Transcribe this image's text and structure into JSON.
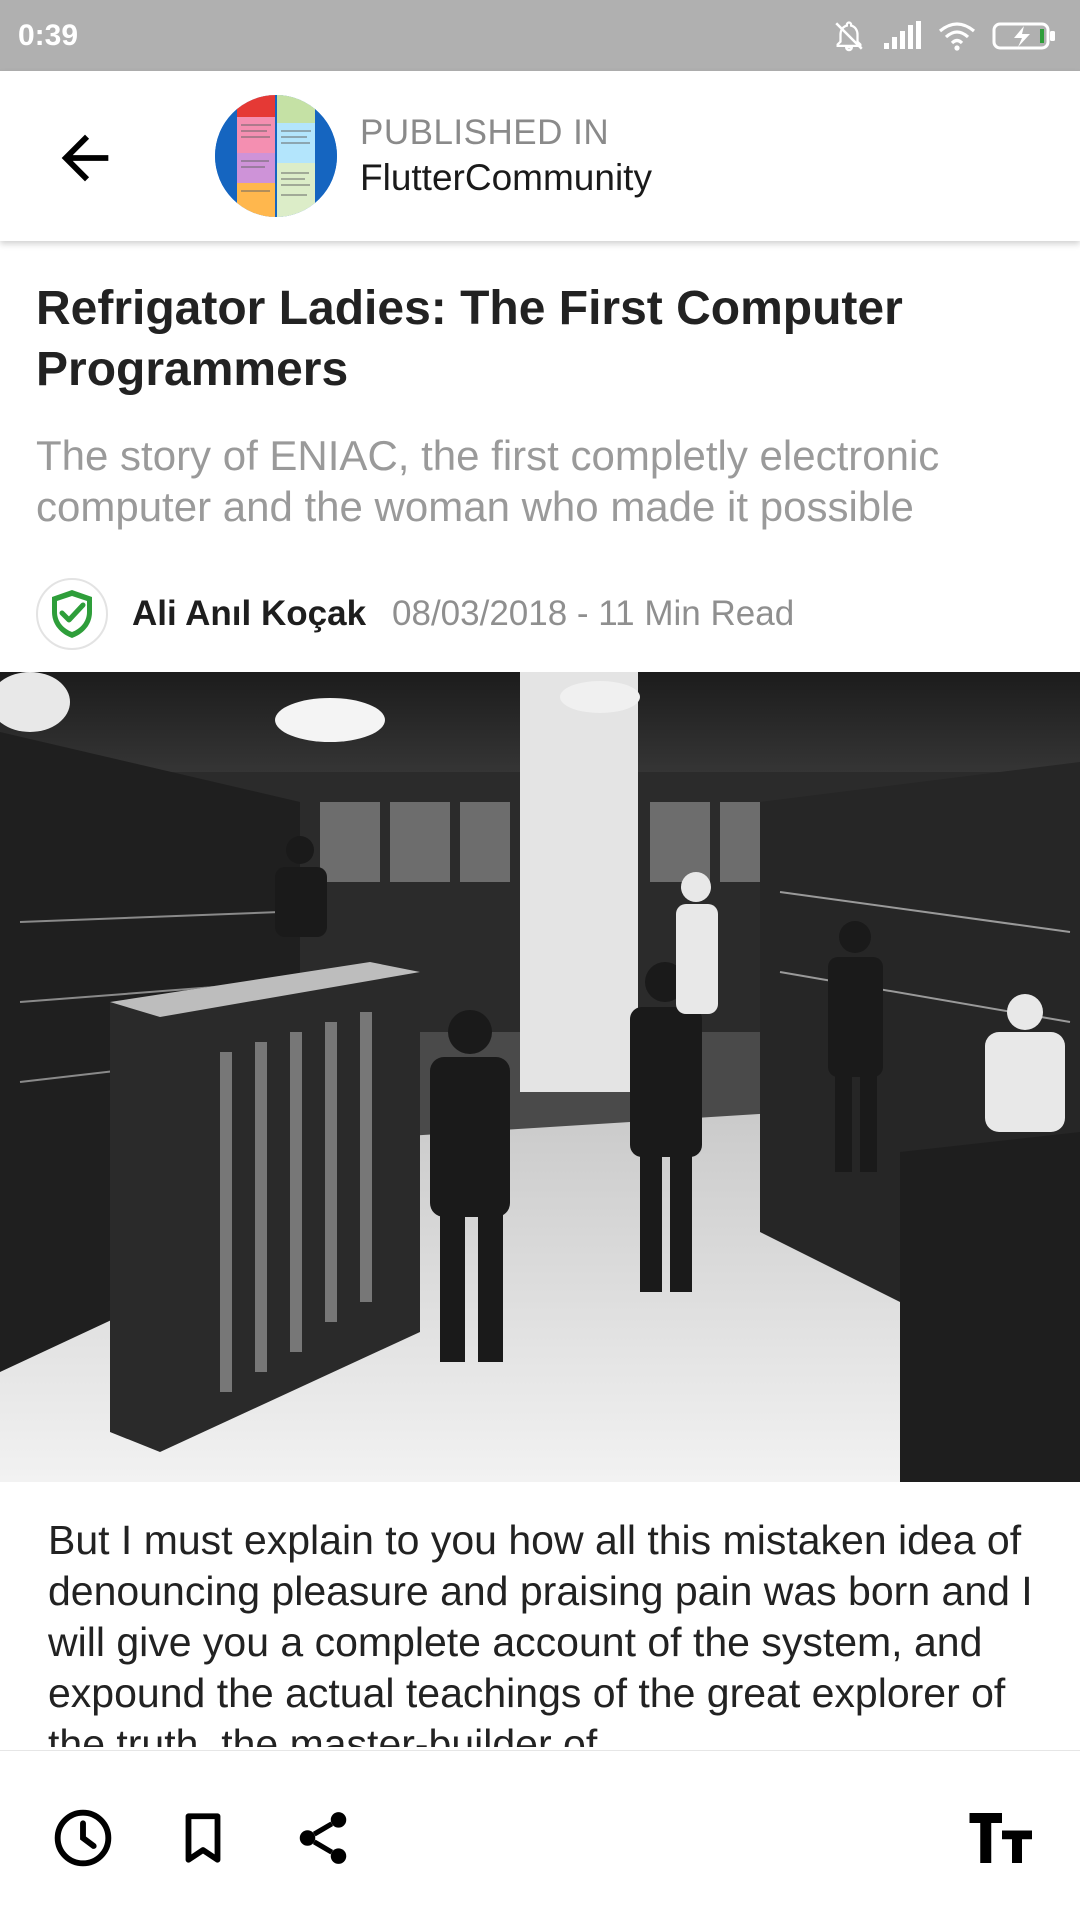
{
  "status_bar": {
    "time": "0:39",
    "icons": [
      "bell-off-icon",
      "signal-icon",
      "wifi-icon",
      "battery-charging-icon"
    ]
  },
  "app_bar": {
    "back_icon": "arrow-left-icon",
    "published_label": "PUBLISHED IN",
    "publication_name": "FlutterCommunity"
  },
  "article": {
    "title": "Refrigator Ladies: The First Computer Programmers",
    "subtitle": "The story of ENIAC, the first completly electronic computer and the woman who made it possible",
    "author": "Ali Anıl Koçak",
    "meta": "08/03/2018 - 11 Min Read",
    "author_avatar_icon": "shield-check-icon",
    "hero_image": "eniac-computer-room-photo",
    "body": "But I must explain to you how all this mistaken idea of denouncing pleasure and praising pain was born and I will give you a complete account of the system, and expound the actual teachings of the great explorer of the truth, the master-builder of"
  },
  "bottom_bar": {
    "icons": [
      "history-clock-icon",
      "bookmark-icon",
      "share-icon",
      "text-size-icon"
    ]
  },
  "colors": {
    "status_bar_bg": "#b0b0b0",
    "accent_green": "#2e9e3a",
    "muted_text": "#8f8f8f"
  }
}
